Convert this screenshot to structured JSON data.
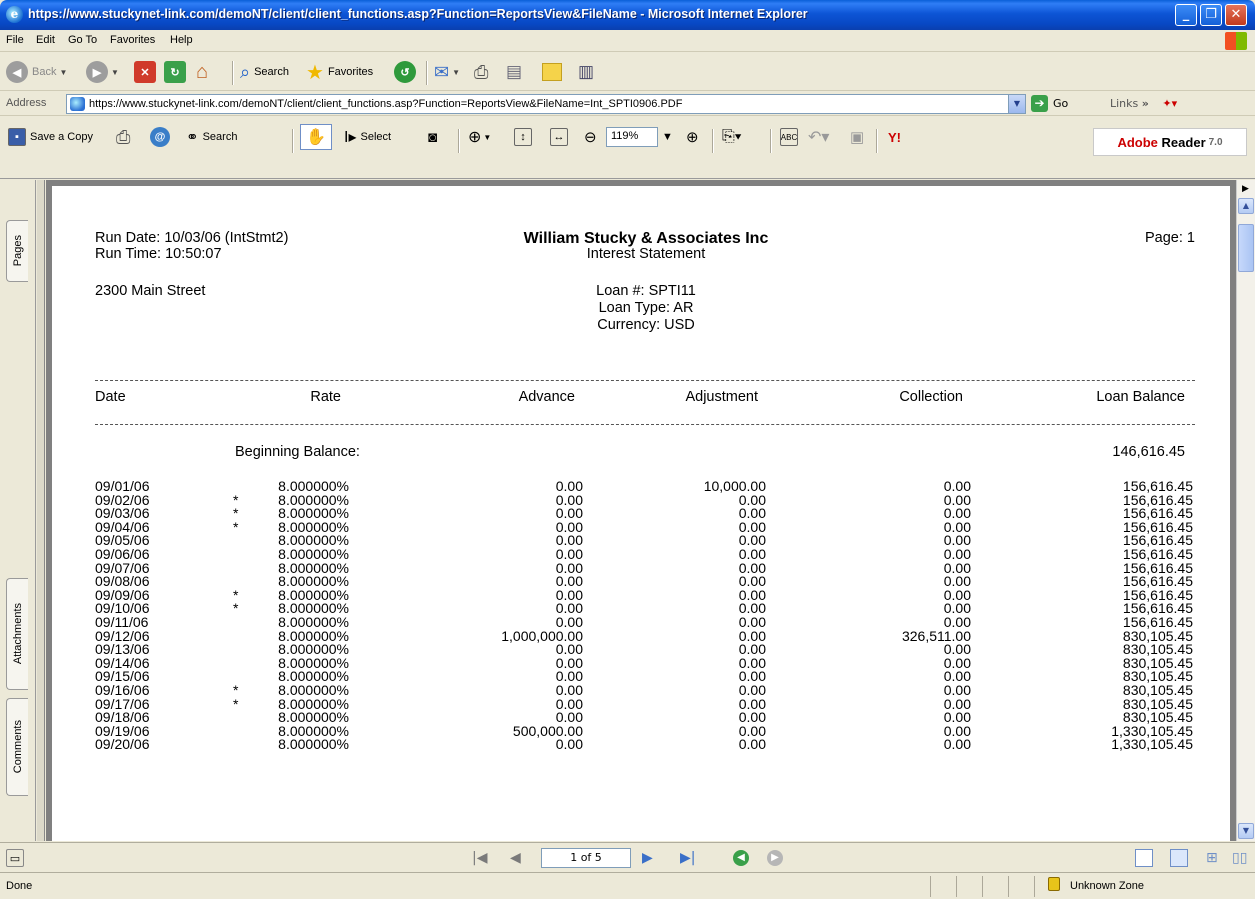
{
  "window": {
    "title": "https://www.stuckynet-link.com/demoNT/client/client_functions.asp?Function=ReportsView&FileName - Microsoft Internet Explorer"
  },
  "menu": [
    "File",
    "Edit",
    "Go To",
    "Favorites",
    "Help"
  ],
  "toolbar": {
    "back_label": "Back",
    "search_label": "Search",
    "favorites_label": "Favorites"
  },
  "address": {
    "label": "Address",
    "url": "https://www.stuckynet-link.com/demoNT/client/client_functions.asp?Function=ReportsView&FileName=Int_SPTI0906.PDF",
    "go_label": "Go",
    "links_label": "Links"
  },
  "adobe_toolbar": {
    "save_copy_label": "Save a Copy",
    "search_label": "Search",
    "select_label": "Select",
    "zoom_value": "119%",
    "logo_brand": "Adobe",
    "logo_product": "Reader",
    "logo_version": "7.0"
  },
  "side_tabs": [
    "Pages",
    "Attachments",
    "Comments"
  ],
  "report": {
    "run_date": "Run Date: 10/03/06 (IntStmt2)",
    "run_time": "Run Time: 10:50:07",
    "company": "William Stucky & Associates Inc",
    "statement_title": "Interest Statement",
    "page_label": "Page: 1",
    "address": "2300 Main Street",
    "loan_number": "Loan #: SPTI11",
    "loan_type": "Loan Type: AR",
    "currency": "Currency: USD",
    "columns": [
      "Date",
      "Rate",
      "Advance",
      "Adjustment",
      "Collection",
      "Loan Balance"
    ],
    "beginning_balance_label": "Beginning Balance:",
    "beginning_balance_value": "146,616.45",
    "rows": [
      {
        "date": "09/01/06",
        "star": "",
        "rate": "8.000000%",
        "advance": "0.00",
        "adjustment": "10,000.00",
        "collection": "0.00",
        "balance": "156,616.45"
      },
      {
        "date": "09/02/06",
        "star": "*",
        "rate": "8.000000%",
        "advance": "0.00",
        "adjustment": "0.00",
        "collection": "0.00",
        "balance": "156,616.45"
      },
      {
        "date": "09/03/06",
        "star": "*",
        "rate": "8.000000%",
        "advance": "0.00",
        "adjustment": "0.00",
        "collection": "0.00",
        "balance": "156,616.45"
      },
      {
        "date": "09/04/06",
        "star": "*",
        "rate": "8.000000%",
        "advance": "0.00",
        "adjustment": "0.00",
        "collection": "0.00",
        "balance": "156,616.45"
      },
      {
        "date": "09/05/06",
        "star": "",
        "rate": "8.000000%",
        "advance": "0.00",
        "adjustment": "0.00",
        "collection": "0.00",
        "balance": "156,616.45"
      },
      {
        "date": "09/06/06",
        "star": "",
        "rate": "8.000000%",
        "advance": "0.00",
        "adjustment": "0.00",
        "collection": "0.00",
        "balance": "156,616.45"
      },
      {
        "date": "09/07/06",
        "star": "",
        "rate": "8.000000%",
        "advance": "0.00",
        "adjustment": "0.00",
        "collection": "0.00",
        "balance": "156,616.45"
      },
      {
        "date": "09/08/06",
        "star": "",
        "rate": "8.000000%",
        "advance": "0.00",
        "adjustment": "0.00",
        "collection": "0.00",
        "balance": "156,616.45"
      },
      {
        "date": "09/09/06",
        "star": "*",
        "rate": "8.000000%",
        "advance": "0.00",
        "adjustment": "0.00",
        "collection": "0.00",
        "balance": "156,616.45"
      },
      {
        "date": "09/10/06",
        "star": "*",
        "rate": "8.000000%",
        "advance": "0.00",
        "adjustment": "0.00",
        "collection": "0.00",
        "balance": "156,616.45"
      },
      {
        "date": "09/11/06",
        "star": "",
        "rate": "8.000000%",
        "advance": "0.00",
        "adjustment": "0.00",
        "collection": "0.00",
        "balance": "156,616.45"
      },
      {
        "date": "09/12/06",
        "star": "",
        "rate": "8.000000%",
        "advance": "1,000,000.00",
        "adjustment": "0.00",
        "collection": "326,511.00",
        "balance": "830,105.45"
      },
      {
        "date": "09/13/06",
        "star": "",
        "rate": "8.000000%",
        "advance": "0.00",
        "adjustment": "0.00",
        "collection": "0.00",
        "balance": "830,105.45"
      },
      {
        "date": "09/14/06",
        "star": "",
        "rate": "8.000000%",
        "advance": "0.00",
        "adjustment": "0.00",
        "collection": "0.00",
        "balance": "830,105.45"
      },
      {
        "date": "09/15/06",
        "star": "",
        "rate": "8.000000%",
        "advance": "0.00",
        "adjustment": "0.00",
        "collection": "0.00",
        "balance": "830,105.45"
      },
      {
        "date": "09/16/06",
        "star": "*",
        "rate": "8.000000%",
        "advance": "0.00",
        "adjustment": "0.00",
        "collection": "0.00",
        "balance": "830,105.45"
      },
      {
        "date": "09/17/06",
        "star": "*",
        "rate": "8.000000%",
        "advance": "0.00",
        "adjustment": "0.00",
        "collection": "0.00",
        "balance": "830,105.45"
      },
      {
        "date": "09/18/06",
        "star": "",
        "rate": "8.000000%",
        "advance": "0.00",
        "adjustment": "0.00",
        "collection": "0.00",
        "balance": "830,105.45"
      },
      {
        "date": "09/19/06",
        "star": "",
        "rate": "8.000000%",
        "advance": "500,000.00",
        "adjustment": "0.00",
        "collection": "0.00",
        "balance": "1,330,105.45"
      },
      {
        "date": "09/20/06",
        "star": "",
        "rate": "8.000000%",
        "advance": "0.00",
        "adjustment": "0.00",
        "collection": "0.00",
        "balance": "1,330,105.45"
      }
    ]
  },
  "navigation": {
    "page_indicator": "1 of 5"
  },
  "status": {
    "text": "Done",
    "zone": "Unknown Zone"
  },
  "colors": {
    "titlebar": "#0a5fd8",
    "adobe_red": "#cc0000",
    "doc_background": "#808080"
  },
  "icons": [
    "ie-logo-icon",
    "back-icon",
    "forward-icon",
    "stop-icon",
    "refresh-icon",
    "home-icon",
    "search-icon",
    "favorites-star-icon",
    "history-icon",
    "mail-icon",
    "print-icon",
    "edit-icon",
    "folder-icon",
    "discuss-icon",
    "go-icon",
    "save-icon",
    "email-icon",
    "binoculars-icon",
    "hand-icon",
    "select-icon",
    "snapshot-icon",
    "zoom-in-icon",
    "fit-page-icon",
    "fit-width-icon",
    "zoom-out-minus-icon",
    "zoom-in-plus-icon",
    "rotate-icon",
    "spellcheck-icon",
    "undo-icon",
    "yahoo-icon",
    "lock-icon"
  ]
}
